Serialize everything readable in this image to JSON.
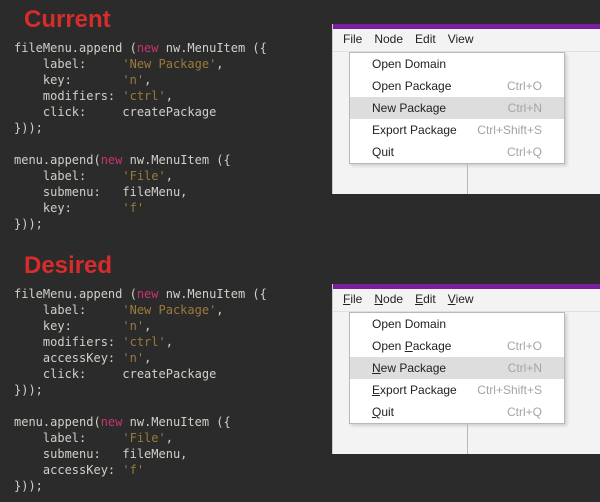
{
  "sections": {
    "current": {
      "heading": "Current"
    },
    "desired": {
      "heading": "Desired"
    }
  },
  "code": {
    "current1": {
      "l1a": "fileMenu.append (",
      "l1kw": "new",
      "l1b": " nw.MenuItem ({",
      "l2a": "    label:     ",
      "l2s": "'New Package'",
      "l2b": ",",
      "l3a": "    key:       ",
      "l3s": "'n'",
      "l3b": ",",
      "l4a": "    modifiers: ",
      "l4s": "'ctrl'",
      "l4b": ",",
      "l5": "    click:     createPackage",
      "l6": "}));"
    },
    "current2": {
      "l1a": "menu.append(",
      "l1kw": "new",
      "l1b": " nw.MenuItem ({",
      "l2a": "    label:     ",
      "l2s": "'File'",
      "l2b": ",",
      "l3": "    submenu:   fileMenu,",
      "l4a": "    key:       ",
      "l4s": "'f'",
      "l5": "}));"
    },
    "desired1": {
      "l1a": "fileMenu.append (",
      "l1kw": "new",
      "l1b": " nw.MenuItem ({",
      "l2a": "    label:     ",
      "l2s": "'New Package'",
      "l2b": ",",
      "l3a": "    key:       ",
      "l3s": "'n'",
      "l3b": ",",
      "l4a": "    modifiers: ",
      "l4s": "'ctrl'",
      "l4b": ",",
      "l5a": "    accessKey: ",
      "l5s": "'n'",
      "l5b": ",",
      "l6": "    click:     createPackage",
      "l7": "}));"
    },
    "desired2": {
      "l1a": "menu.append(",
      "l1kw": "new",
      "l1b": " nw.MenuItem ({",
      "l2a": "    label:     ",
      "l2s": "'File'",
      "l2b": ",",
      "l3": "    submenu:   fileMenu,",
      "l4a": "    accessKey: ",
      "l4s": "'f'",
      "l5": "}));"
    }
  },
  "menubar": {
    "file": "File",
    "node": "Node",
    "edit": "Edit",
    "view": "View"
  },
  "dropdown": {
    "r0": {
      "label": "Open Domain",
      "sc": ""
    },
    "r1": {
      "label": "Open Package",
      "sc": "Ctrl+O"
    },
    "r2": {
      "label": "New Package",
      "sc": "Ctrl+N"
    },
    "r3": {
      "label": "Export Package",
      "sc": "Ctrl+Shift+S"
    },
    "r4": {
      "label": "Quit",
      "sc": "Ctrl+Q"
    }
  },
  "dropdown_underlined": {
    "r0": {
      "pre": "",
      "u": "",
      "post": "Open Domain",
      "sc": ""
    },
    "r1": {
      "pre": "Open ",
      "u": "P",
      "post": "ackage",
      "sc": "Ctrl+O"
    },
    "r2": {
      "pre": "",
      "u": "N",
      "post": "ew Package",
      "sc": "Ctrl+N"
    },
    "r3": {
      "pre": "",
      "u": "E",
      "post": "xport Package",
      "sc": "Ctrl+Shift+S"
    },
    "r4": {
      "pre": "",
      "u": "Q",
      "post": "uit",
      "sc": "Ctrl+Q"
    }
  }
}
